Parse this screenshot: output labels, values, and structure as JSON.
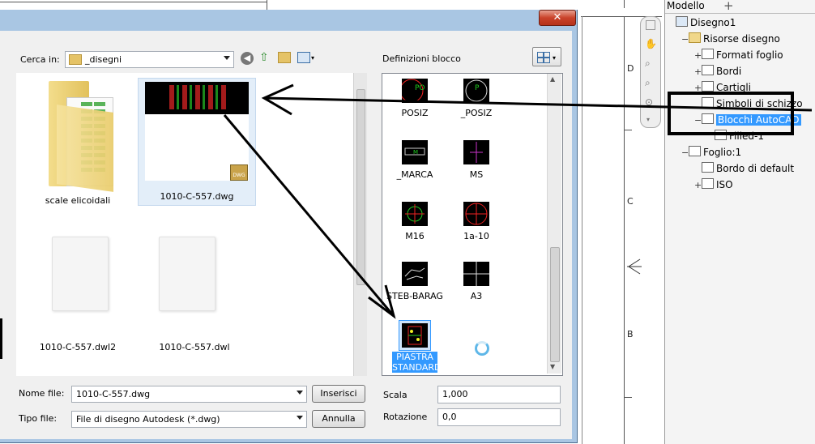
{
  "drawing": {
    "zones": [
      "D",
      "C",
      "B"
    ]
  },
  "dialog": {
    "close_glyph": "✕",
    "look_in_label": "Cerca in:",
    "look_in_value": "_disegni",
    "block_defs_label": "Definizioni blocco",
    "files": [
      {
        "name": "scale elicoidali",
        "type": "folder"
      },
      {
        "name": "1010-C-557.dwg",
        "type": "dwg",
        "selected": true
      },
      {
        "name": "1010-C-557.dwl2",
        "type": "file"
      },
      {
        "name": "1010-C-557.dwl",
        "type": "file"
      }
    ],
    "blocks": [
      {
        "name": "POSIZ"
      },
      {
        "name": "_POSIZ"
      },
      {
        "name": "_MARCA"
      },
      {
        "name": "MS"
      },
      {
        "name": "M16"
      },
      {
        "name": "1a-10"
      },
      {
        "name": "STEB-BARAG"
      },
      {
        "name": "A3"
      },
      {
        "name": "PIASTRA STANDARD",
        "selected": true
      },
      {
        "name": "",
        "loading": true
      }
    ],
    "file_name_label": "Nome file:",
    "file_name_value": "1010-C-557.dwg",
    "file_type_label": "Tipo file:",
    "file_type_value": "File di disegno Autodesk (*.dwg)",
    "insert_button": "Inserisci",
    "cancel_button": "Annulla",
    "scale_label": "Scala",
    "scale_value": "1,000",
    "rotation_label": "Rotazione",
    "rotation_value": "0,0"
  },
  "browser": {
    "header": "Modello",
    "add_glyph": "+",
    "items": [
      {
        "label": "Disegno1",
        "level": 0,
        "expander": ""
      },
      {
        "label": "Risorse disegno",
        "level": 1,
        "expander": "−"
      },
      {
        "label": "Formati foglio",
        "level": 2,
        "expander": "+"
      },
      {
        "label": "Bordi",
        "level": 2,
        "expander": "+"
      },
      {
        "label": "Cartigli",
        "level": 2,
        "expander": "+"
      },
      {
        "label": "Simboli di schizzo",
        "level": 2,
        "expander": ""
      },
      {
        "label": "Blocchi AutoCAD",
        "level": 2,
        "expander": "−",
        "highlighted": true
      },
      {
        "label": "Filled-1",
        "level": 3,
        "expander": ""
      },
      {
        "label": "Foglio:1",
        "level": 1,
        "expander": "−"
      },
      {
        "label": "Bordo di default",
        "level": 2,
        "expander": ""
      },
      {
        "label": "ISO",
        "level": 2,
        "expander": "+"
      }
    ]
  },
  "colors": {
    "highlight": "#3399ff",
    "dialog_frame": "#a9c6e3",
    "close_red": "#c9432a"
  }
}
